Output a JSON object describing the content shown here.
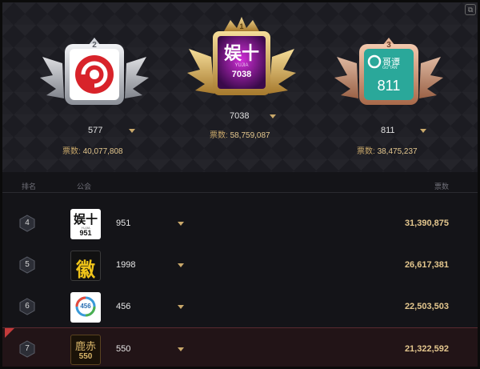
{
  "header": {
    "corner_icon": "window-icon"
  },
  "podium": [
    {
      "rank": "2",
      "name": "577",
      "votes_label": "票数:",
      "votes": "40,077,808",
      "accent": "#c6c9cf"
    },
    {
      "rank": "1",
      "name": "7038",
      "votes_label": "票数:",
      "votes": "58,759,087",
      "accent": "#d8b35a"
    },
    {
      "rank": "3",
      "name": "811",
      "votes_label": "票数:",
      "votes": "38,475,237",
      "accent": "#d69a7a"
    }
  ],
  "logos": {
    "first_text": "娱十",
    "first_sub": "YUJIA",
    "first_num": "7038",
    "third_name": "哥谭",
    "third_sub": "GU TAN",
    "third_num": "811",
    "row4_text": "娱十",
    "row4_sub": "YUJIA",
    "row4_num": "951",
    "row5_text": "徽",
    "row6_text": "456",
    "row7_text": "鹿赤",
    "row7_num": "550"
  },
  "table": {
    "col_rank": "排名",
    "col_guild": "公会",
    "col_votes": "票数",
    "rows": [
      {
        "rank": "4",
        "guild": "951",
        "votes": "31,390,875"
      },
      {
        "rank": "5",
        "guild": "1998",
        "votes": "26,617,381"
      },
      {
        "rank": "6",
        "guild": "456",
        "votes": "22,503,503"
      },
      {
        "rank": "7",
        "guild": "550",
        "votes": "21,322,592"
      }
    ]
  },
  "colors": {
    "gold": "#e4c78e",
    "background": "#141418",
    "highlight_row": "#221417"
  }
}
